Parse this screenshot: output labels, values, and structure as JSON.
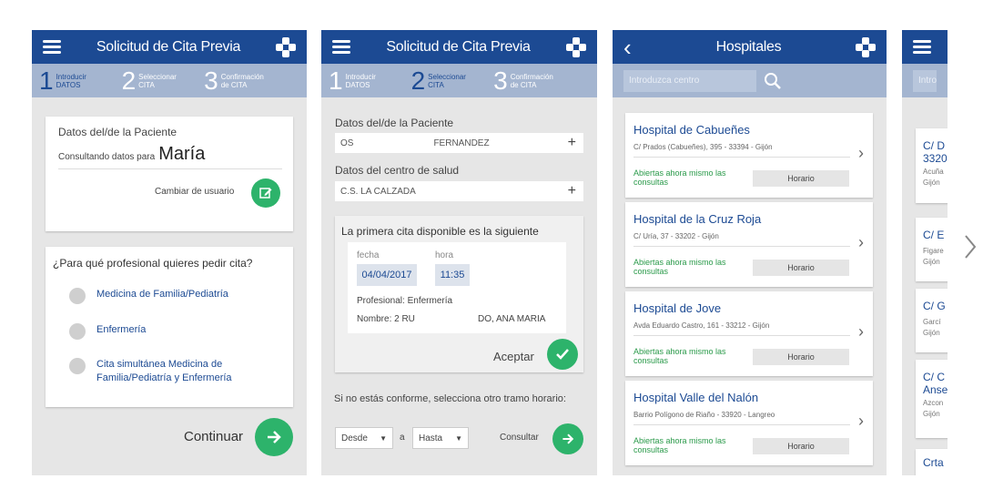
{
  "screen1": {
    "title": "Solicitud de Cita Previa",
    "steps": [
      {
        "num": "1",
        "label": "Introducir DATOS"
      },
      {
        "num": "2",
        "label": "Seleccionar CITA"
      },
      {
        "num": "3",
        "label": "Confirmación de CITA"
      }
    ],
    "patient_card_title": "Datos del/de la Paciente",
    "consulting_label": "Consultando datos para",
    "patient_name": "María",
    "change_user": "Cambiar de usuario",
    "question": "¿Para qué profesional quieres pedir cita?",
    "options": [
      "Medicina de Familia/Pediatría",
      "Enfermería",
      "Cita simultánea Medicina de Familia/Pediatría y Enfermería"
    ],
    "continue": "Continuar"
  },
  "screen2": {
    "title": "Solicitud de Cita Previa",
    "steps": [
      {
        "num": "1",
        "label": "Introducir DATOS"
      },
      {
        "num": "2",
        "label": "Seleccionar CITA"
      },
      {
        "num": "3",
        "label": "Confirmación de CITA"
      }
    ],
    "patient_label": "Datos del/de la Paciente",
    "patient_field_left": "OS",
    "patient_field_right": "FERNANDEZ",
    "center_label": "Datos del centro de salud",
    "center_value": "C.S. LA CALZADA",
    "first_slot": "La primera cita disponible es la siguiente",
    "fecha_label": "fecha",
    "fecha_value": "04/04/2017",
    "hora_label": "hora",
    "hora_value": "11:35",
    "profesional": "Profesional: Enfermería",
    "nombre": "Nombre: 2 RU",
    "doctor": "DO, ANA MARIA",
    "accept": "Aceptar",
    "other_slot": "Si no estás conforme, selecciona otro tramo horario:",
    "desde": "Desde",
    "a": "a",
    "hasta": "Hasta",
    "consultar": "Consultar"
  },
  "screen3": {
    "title": "Hospitales",
    "search_placeholder": "Introduzca centro",
    "hospitals": [
      {
        "name": "Hospital de Cabueñes",
        "address": "C/ Prados (Cabueñes), 395 - 33394 - Gijón",
        "open": "Abiertas ahora mismo las consultas",
        "button": "Horario"
      },
      {
        "name": "Hospital de la Cruz Roja",
        "address": "C/ Uría, 37 - 33202 - Gijón",
        "open": "Abiertas ahora mismo las consultas",
        "button": "Horario"
      },
      {
        "name": "Hospital de Jove",
        "address": "Avda Eduardo Castro, 161 - 33212 - Gijón",
        "open": "Abiertas ahora mismo las consultas",
        "button": "Horario"
      },
      {
        "name": "Hospital Valle del Nalón",
        "address": "Barrio Polígono de Riaño - 33920 - Langreo",
        "open": "Abiertas ahora mismo las consultas",
        "button": "Horario"
      }
    ]
  },
  "screen4": {
    "search_placeholder": "Introd",
    "cards": [
      {
        "l1": "C/ D",
        "l2": "3320",
        "l3": "Acuña",
        "l4": "Gijón"
      },
      {
        "l1": "C/ E",
        "l2": "",
        "l3": "Figare",
        "l4": "Gijón"
      },
      {
        "l1": "C/ G",
        "l2": "",
        "l3": "Garcí",
        "l4": "Gijón"
      },
      {
        "l1": "C/ C",
        "l2": "Anse",
        "l3": "Azcon",
        "l4": "Gijón"
      },
      {
        "l1": "Crta",
        "l2": "",
        "l3": "",
        "l4": ""
      }
    ]
  },
  "colors": {
    "primary": "#1c4a93",
    "steps_bg": "#a4b5d0",
    "accent_green": "#2db36b",
    "background": "#e6e6e6"
  }
}
